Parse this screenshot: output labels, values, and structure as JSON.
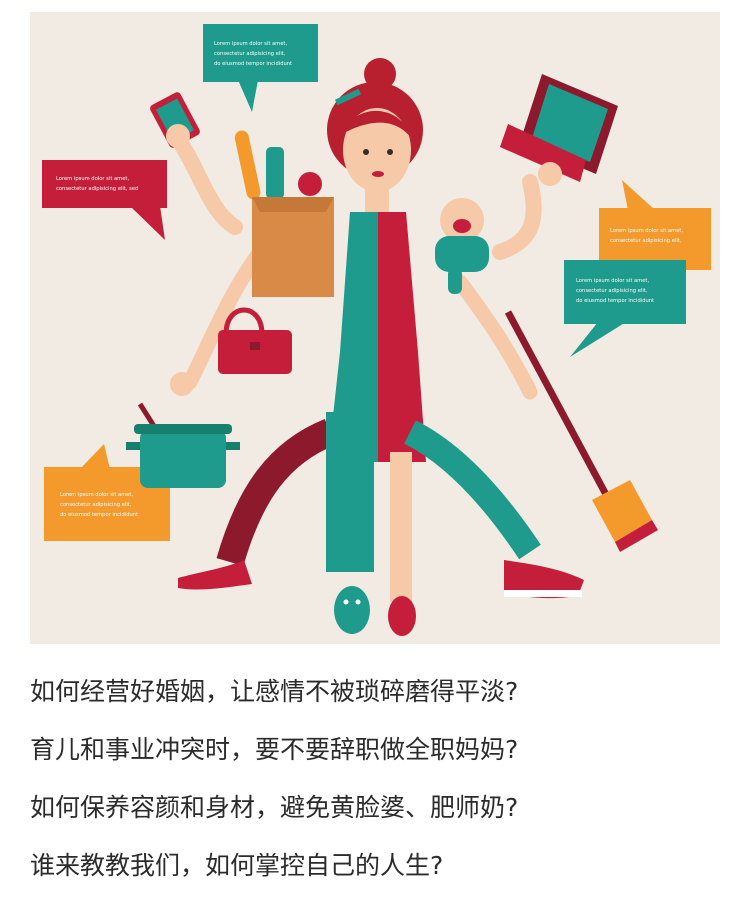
{
  "illustration": {
    "colors": {
      "background": "#f1ebe4",
      "teal": "#1e9b8c",
      "red": "#c41e3a",
      "maroon": "#8c1a2c",
      "orange": "#f49a2c",
      "skin": "#f6c9a8",
      "hair": "#b9202f",
      "paper_bag": "#d88a46"
    },
    "bubbles": [
      {
        "lines": [
          "Lorem ipsum dolor sit amet,",
          "consectetur adipisicing elit,",
          "do eiusmod tempor incididunt"
        ]
      },
      {
        "lines": [
          "Lorem ipsum dolor sit amet,",
          "consectetur adipisicing elit, sed"
        ]
      },
      {
        "lines": [
          "Lorem ipsum dolor sit amet,",
          "consectetur adipisicing elit,"
        ]
      },
      {
        "lines": [
          "Lorem ipsum dolor sit amet,",
          "consectetur adipisicing elit,",
          "do eiusmod tempor incididunt"
        ]
      },
      {
        "lines": [
          "Lorem ipsum dolor sit amet,",
          "consectetur adipisicing elit,",
          "do eiusmod tempor incididunt"
        ]
      }
    ]
  },
  "questions": [
    "如何经营好婚姻，让感情不被琐碎磨得平淡?",
    "育儿和事业冲突时，要不要辞职做全职妈妈?",
    "如何保养容颜和身材，避免黄脸婆、肥师奶?",
    "谁来教教我们，如何掌控自己的人生?"
  ]
}
